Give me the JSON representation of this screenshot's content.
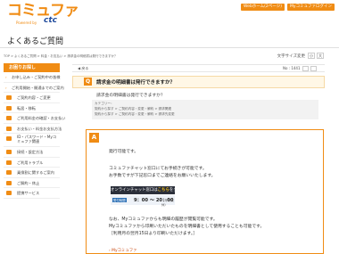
{
  "header": {
    "logo_text": "コミュファ",
    "logo_sub": "Powered by ctc",
    "logo_ctc": "ctc",
    "web_button": "Webホーム(2ページ)",
    "my_button": "Myコミュファログイン",
    "page_title": "よくあるご質問"
  },
  "breadcrumb": "TOP > よくあるご質問 > 料金・お支払い > 請求金の明細書は発行できますか？",
  "font_size": {
    "label": "文字サイズ変更",
    "small": "小",
    "large": "大"
  },
  "sidebar": {
    "head": "お困りお探し",
    "items": [
      {
        "label": "お申し込み・ご契約中の皆様",
        "icon": "arrow-icon"
      },
      {
        "label": "ご利用開始・開通までのご案内",
        "icon": "arrow-icon"
      },
      {
        "label": "ご契約内容・ご変更",
        "icon": "document-icon"
      },
      {
        "label": "転居・移転",
        "icon": "house-icon"
      },
      {
        "label": "ご利用料金の確認・お支払い",
        "icon": "yen-icon"
      },
      {
        "label": "お支払い・料金お支払方法",
        "icon": "card-icon"
      },
      {
        "label": "ID・パスワード・Myコミュファ関連",
        "icon": "key-icon"
      },
      {
        "label": "接続・設定方法",
        "icon": "plug-icon"
      },
      {
        "label": "ご利用トラブル",
        "icon": "warning-icon"
      },
      {
        "label": "乗換割に関するご案内",
        "icon": "tag-icon"
      },
      {
        "label": "ご解約・休止",
        "icon": "close-icon"
      },
      {
        "label": "提携サービス",
        "icon": "link-icon"
      }
    ]
  },
  "toolbar": {
    "back": "◀ 戻る",
    "no": "No : 1441",
    "print_icon": "print-icon",
    "mail_icon": "mail-icon"
  },
  "question": {
    "badge": "Q",
    "title": "請求金の明細書は発行できますか？",
    "subtitle": "請求金の明細書は発行できますか？",
    "category_label": "カテゴリー：",
    "category_1": "契約から探す > ご契約内容・変更・解約 > 請求関連",
    "category_2": "契約から探す > ご契約内容・変更・解約 > 請求先変更"
  },
  "answer": {
    "badge": "A",
    "line1": "発行可能です。",
    "line2": "コミュファチャット窓口にてお手続きが可能です。",
    "line3": "お手数ですが下記窓口までご連絡をお願いいたします。",
    "chat_button_pre": "オンラインチャット窓口は",
    "chat_button_highlight": "こちら",
    "chat_button_post": "をクリック",
    "hours_label": "受付時間",
    "hours_time": "9：00 〜 20：00",
    "hours_note": "（年中無休）",
    "line4": "なお、Myコミュファからも明細の履歴が閲覧可能です。",
    "line5": "Myコミュファから印刷いただいたものを明細書として使用することも可能です。",
    "line6": "［利用月の翌月15日より印刷いただけます。］",
    "my_link": "Myコミュファ"
  },
  "colors": {
    "brand_orange": "#f08c14",
    "ctc_blue": "#1f4a9c"
  }
}
